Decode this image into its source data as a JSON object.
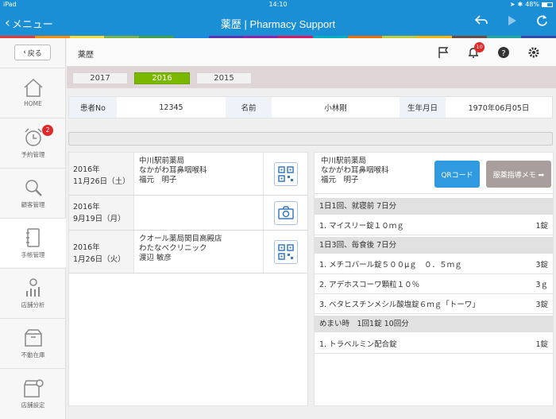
{
  "status": {
    "carrier": "iPad",
    "time": "14:10",
    "battery": "48%"
  },
  "nav": {
    "back_label": "メニュー",
    "title": "薬歴 | Pharmacy Support"
  },
  "colors": {
    "accent": "#1a8fd6",
    "active_year": "#7ab800",
    "badge": "#e02a2a",
    "qr_button": "#2f9ae0",
    "memo_button": "#a89e9b"
  },
  "rainbow": [
    "#e53935",
    "#fb8c00",
    "#fdd835",
    "#7cb342",
    "#43a047",
    "#1e88e5",
    "#5e35b1",
    "#8e24aa",
    "#d81b60",
    "#00acc1",
    "#ef6c00",
    "#c0ca33",
    "#ffb300",
    "#6d4c41",
    "#26a69a",
    "#3949ab"
  ],
  "sidebar": {
    "back_label": "戻る",
    "items": [
      {
        "label": "HOME",
        "icon": "home-icon"
      },
      {
        "label": "予約管理",
        "icon": "alarm-clock-icon",
        "badge": "2"
      },
      {
        "label": "顧客管理",
        "icon": "search-icon"
      },
      {
        "label": "手帳管理",
        "icon": "notebook-icon"
      },
      {
        "label": "店舗分析",
        "icon": "analytics-icon"
      },
      {
        "label": "不動在庫",
        "icon": "box-icon"
      },
      {
        "label": "店舗設定",
        "icon": "store-settings-icon"
      }
    ]
  },
  "header": {
    "title": "薬歴",
    "notification_count": "10"
  },
  "years": [
    "2017",
    "2016",
    "2015"
  ],
  "selected_year": "2016",
  "patient": {
    "id_label": "患者No",
    "id_value": "12345",
    "name_label": "名前",
    "name_value": "小林剛",
    "birth_label": "生年月日",
    "birth_value": "1970年06月05日"
  },
  "history": [
    {
      "year": "2016年",
      "date": "11月26日（土）",
      "pharmacy": "中川駅前薬局",
      "clinic": "なかがわ耳鼻咽喉科",
      "person": "福元　明子",
      "action": "qr-code-icon"
    },
    {
      "year": "2016年",
      "date": "9月19日（月）",
      "pharmacy": "",
      "clinic": "",
      "person": "",
      "action": "camera-icon"
    },
    {
      "year": "2016年",
      "date": "1月26日（火）",
      "pharmacy": "クオール薬局関目高殿店",
      "clinic": "わたなべクリニック",
      "person": "渡辺 敏彦",
      "action": "qr-code-icon"
    }
  ],
  "detail": {
    "pharmacy": "中川駅前薬局",
    "clinic": "なかがわ耳鼻咽喉科",
    "person": "福元　明子",
    "qr_label": "QRコード",
    "memo_label": "服薬指導メモ ➡"
  },
  "prescriptions": [
    {
      "header": "1日1回、就寝前 7日分",
      "items": [
        {
          "name": "1. マイスリー錠１０ｍｇ",
          "qty": "1錠"
        }
      ]
    },
    {
      "header": "1日3回、毎食後 7日分",
      "items": [
        {
          "name": "1. メチコバール錠５００μｇ　０．５ｍｇ",
          "qty": "3錠"
        },
        {
          "name": "2. アデホスコーワ顆粒１０％",
          "qty": "3ｇ"
        },
        {
          "name": "3. ベタヒスチンメシル酸塩錠６ｍｇ「トーワ」",
          "qty": "3錠"
        }
      ]
    },
    {
      "header": "めまい時　1回1錠 10回分",
      "items": [
        {
          "name": "1. トラベルミン配合錠",
          "qty": "1錠"
        }
      ]
    }
  ]
}
